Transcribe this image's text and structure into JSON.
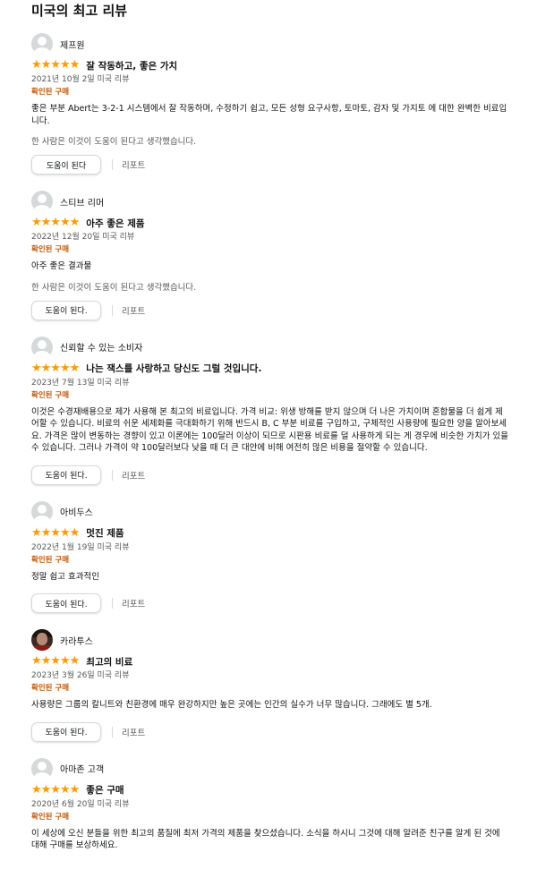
{
  "heading": "미국의 최고 리뷰",
  "reviews": [
    {
      "name": "제프원",
      "avatar": "default",
      "stars": "★★★★★",
      "title": "잘 작동하고, 좋은 가치",
      "date": "2021년 10월 2일 미국 리뷰",
      "verified": "확인된 구매",
      "body": "좋은 부분 Abert는 3-2-1 시스템에서 잘 작동하며, 수정하기 쉽고, 모든 성형 요구사항, 토마토, 감자 및 가지토 에 대한 완벽한 비료입니다.",
      "helpful": "한 사람은 이것이 도움이 된다고 생각했습니다.",
      "helpful_button": "도움이 된다",
      "report": "리포트"
    },
    {
      "name": "스티브 리머",
      "avatar": "default",
      "stars": "★★★★★",
      "title": "아주 좋은 제품",
      "date": "2022년 12월 20일 미국 리뷰",
      "verified": "확인된 구매",
      "body": "아주 좋은 결과물",
      "helpful": "한 사람은 이것이 도움이 된다고 생각했습니다.",
      "helpful_button": "도움이 된다.",
      "report": "리포트"
    },
    {
      "name": "신뢰할 수 있는 소비자",
      "avatar": "default",
      "stars": "★★★★★",
      "title": "나는 잭스를 사랑하고 당신도 그럴 것입니다.",
      "date": "2023년 7월 13일 미국 리뷰",
      "verified": "확인된 구매",
      "body": "이것은 수경재배용으로 제가 사용해 본 최고의 비료입니다. 가격 비교: 위생 방해를 받지 않으며 더 나은 가치이며 혼합물을 더 쉽게 제어할 수 있습니다. 비료의 쉬운 세제화를 극대화하기 위해 반드시 B, C 부분 비료를 구입하고, 구체적인 사용량에 필요한 양을 알아보세요. 가격은 많이 변동하는 경향이 있고 이론에는 100달러 이상이 되므로 시판용 비료를 덜 사용하게 되는 게 경우에 비슷한 가치가 있을 수 있습니다. 그러나 가격이 약 100달러보다 낮을 때 더 큰 대안에 비해 여전히 많은 비용을 절약할 수 있습니다.",
      "helpful": "",
      "helpful_button": "도움이 된다.",
      "report": "리포트"
    },
    {
      "name": "아비두스",
      "avatar": "default",
      "stars": "★★★★★",
      "title": "멋진 제품",
      "date": "2022년 1월 19일 미국 리뷰",
      "verified": "확인된 구매",
      "body": "정말 쉽고 효과적인",
      "helpful": "",
      "helpful_button": "도움이 된다.",
      "report": "리포트"
    },
    {
      "name": "카라투스",
      "avatar": "photo",
      "stars": "★★★★★",
      "title": "최고의 비료",
      "date": "2023년 3월 26일 미국 리뷰",
      "verified": "확인된 구매",
      "body": "사용량은 그룹의 칼니트와 친환경에 매우 완강하지만 높은 곳에는 인간의 실수가 너무 많습니다. 그래에도 별 5개.",
      "helpful": "",
      "helpful_button": "도움이 된다.",
      "report": "리포트"
    },
    {
      "name": "아마존 고객",
      "avatar": "default",
      "stars": "★★★★★",
      "title": "좋은 구매",
      "date": "2020년 6월 20일 미국 리뷰",
      "verified": "확인된 구매",
      "body": "이 세상에 오신 분들을 위한 최고의 품질에 최저 가격의 제품을 찾으셨습니다. 소식을 하시니 그것에 대해 알려준 친구를 알게 된 것에 대해 구매를 보상하세요.",
      "helpful": "",
      "helpful_button": "",
      "report": ""
    }
  ]
}
